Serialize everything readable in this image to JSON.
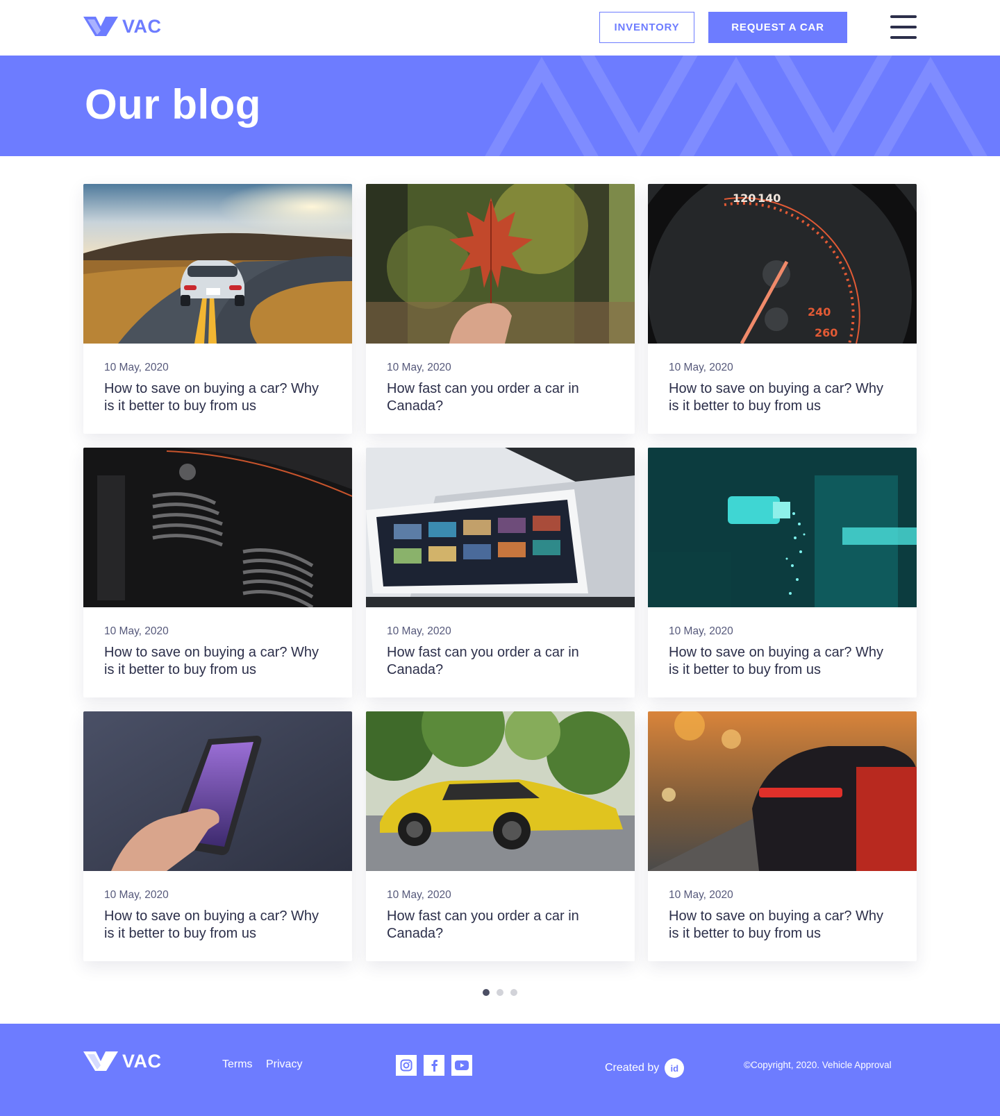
{
  "header": {
    "logo_text": "VAC",
    "inventory_label": "INVENTORY",
    "request_label": "REQUEST A CAR"
  },
  "hero": {
    "title": "Our blog"
  },
  "posts": [
    {
      "date": "10 May, 2020",
      "title": "How to save on buying a car? Why is it better to buy from us",
      "image": "sports-car-on-road"
    },
    {
      "date": "10 May, 2020",
      "title": "How fast can you order a car in Canada?",
      "image": "maple-leaf-in-hand"
    },
    {
      "date": "10 May, 2020",
      "title": "How to save on buying a car? Why is it better to buy from us",
      "image": "speedometer"
    },
    {
      "date": "10 May, 2020",
      "title": "How to save on buying a car? Why is it better to buy from us",
      "image": "motorcycle-engine"
    },
    {
      "date": "10 May, 2020",
      "title": "How fast can you order a car in Canada?",
      "image": "tablet-on-laptop"
    },
    {
      "date": "10 May, 2020",
      "title": "How to save on buying a car? Why is it better to buy from us",
      "image": "teal-machinery"
    },
    {
      "date": "10 May, 2020",
      "title": "How to save on buying a car? Why is it better to buy from us",
      "image": "phone-in-hand"
    },
    {
      "date": "10 May, 2020",
      "title": "How fast can you order a car in Canada?",
      "image": "yellow-sports-car"
    },
    {
      "date": "10 May, 2020",
      "title": "How to save on buying a car? Why is it better to buy from us",
      "image": "car-taillights-city"
    }
  ],
  "pagination": {
    "pages": 3,
    "active": 1
  },
  "footer": {
    "logo_text": "VAC",
    "terms": "Terms",
    "privacy": "Privacy",
    "created_by": "Created by",
    "badge": "id",
    "copyright": "©Copyright, 2020. Vehicle Approval"
  },
  "colors": {
    "accent": "#6d7cff",
    "text": "#2c2f4a"
  }
}
